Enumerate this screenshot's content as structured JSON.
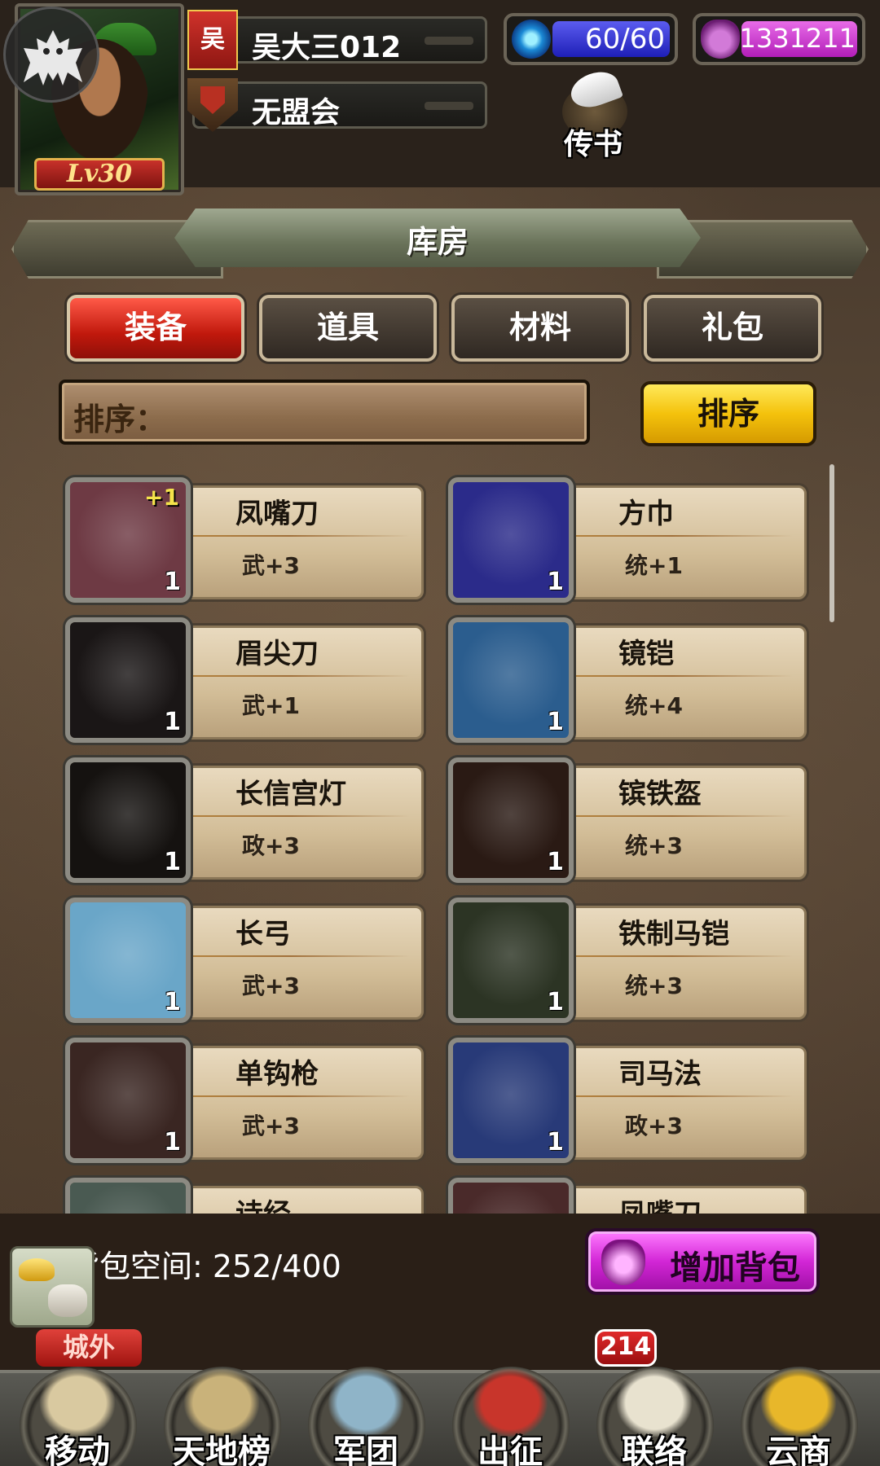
{
  "player": {
    "level": "Lv30",
    "faction": "吴",
    "name": "吴大三012",
    "guild": "无盟会"
  },
  "resources": {
    "energy": "60/60",
    "gold": "1331211"
  },
  "message": {
    "label": "传书"
  },
  "title": "库房",
  "tabs": [
    "装备",
    "道具",
    "材料",
    "礼包"
  ],
  "active_tab": "装备",
  "sort": {
    "field_label": "排序：",
    "button_label": "排序"
  },
  "items": [
    {
      "name": "凤嘴刀",
      "stat": "武+3",
      "qty": "1",
      "plus": "+1",
      "icon": "blade-icon",
      "bg": "#6e3a44"
    },
    {
      "name": "方巾",
      "stat": "统+1",
      "qty": "1",
      "plus": "",
      "icon": "headscarf-icon",
      "bg": "#2b2b8a"
    },
    {
      "name": "眉尖刀",
      "stat": "武+1",
      "qty": "1",
      "plus": "",
      "icon": "blade-icon",
      "bg": "#1a1616"
    },
    {
      "name": "镜铠",
      "stat": "统+4",
      "qty": "1",
      "plus": "",
      "icon": "armor-icon",
      "bg": "#2b5d8e"
    },
    {
      "name": "长信宫灯",
      "stat": "政+3",
      "qty": "1",
      "plus": "",
      "icon": "lamp-icon",
      "bg": "#151210"
    },
    {
      "name": "镔铁盔",
      "stat": "统+3",
      "qty": "1",
      "plus": "",
      "icon": "helmet-icon",
      "bg": "#2a1a14"
    },
    {
      "name": "长弓",
      "stat": "武+3",
      "qty": "1",
      "plus": "",
      "icon": "bow-icon",
      "bg": "#6aa6c8"
    },
    {
      "name": "铁制马铠",
      "stat": "统+3",
      "qty": "1",
      "plus": "",
      "icon": "horse-armor-icon",
      "bg": "#2c3424"
    },
    {
      "name": "单钩枪",
      "stat": "武+3",
      "qty": "1",
      "plus": "",
      "icon": "spear-icon",
      "bg": "#3a2622"
    },
    {
      "name": "司马法",
      "stat": "政+3",
      "qty": "1",
      "plus": "",
      "icon": "scroll-icon",
      "bg": "#283a78"
    },
    {
      "name": "诗经",
      "stat": "",
      "qty": "",
      "plus": "",
      "icon": "book-icon",
      "bg": "#4a5a52"
    },
    {
      "name": "凤嘴刀",
      "stat": "",
      "qty": "",
      "plus": "",
      "icon": "blade-icon",
      "bg": "#4a2a2a"
    }
  ],
  "bag": {
    "space_label": "背包空间: 252/400",
    "add_label": "增加背包",
    "outside_label": "城外"
  },
  "nav": [
    {
      "label": "移动",
      "icon": "map-icon"
    },
    {
      "label": "天地榜",
      "icon": "ranking-scroll-icon"
    },
    {
      "label": "军团",
      "icon": "horn-icon"
    },
    {
      "label": "出征",
      "icon": "war-flag-icon"
    },
    {
      "label": "联络",
      "icon": "letter-icon"
    },
    {
      "label": "云商",
      "icon": "treasure-icon"
    }
  ],
  "mail_count": "214",
  "colors": {
    "active_tab": "#c0180c",
    "sort_button": "#f4c20c",
    "add_bag": "#d226d6",
    "energy": "#1e1fb7",
    "gold_bar": "#b21db8"
  }
}
